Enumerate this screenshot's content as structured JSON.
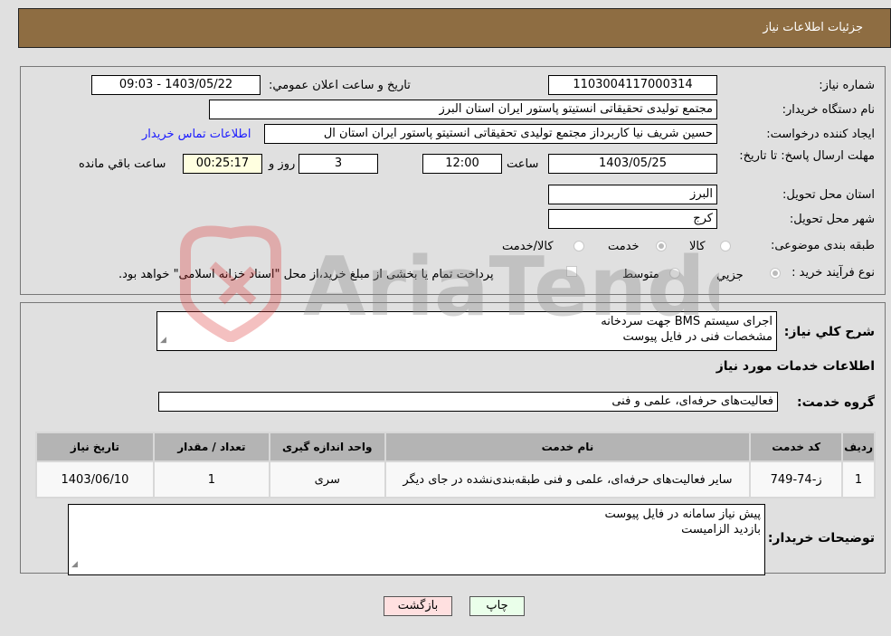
{
  "header": {
    "title": "جزئیات اطلاعات نیاز"
  },
  "form": {
    "need_number_label": "شماره نیاز:",
    "need_number": "1103004117000314",
    "announce_label": "تاریخ و ساعت اعلان عمومي:",
    "announce_value": "1403/05/22 - 09:03",
    "buyer_org_label": "نام دستگاه خريدار:",
    "buyer_org": "مجتمع تولیدی تحقیقاتی انستیتو پاستور ایران استان البرز",
    "creator_label": "ايجاد کننده درخواست:",
    "creator": "حسین شریف نیا کاربرداز مجتمع تولیدی تحقیقاتی انستیتو پاستور ایران استان ال",
    "contact_link": "اطلاعات تماس خريدار",
    "deadline_label": "مهلت ارسال پاسخ: تا تاریخ:",
    "deadline_date": "1403/05/25",
    "time_label": "ساعت",
    "deadline_time": "12:00",
    "days_value": "3",
    "days_label": "روز و",
    "remaining_value": "00:25:17",
    "remaining_label": "ساعت باقي مانده",
    "province_label": "استان محل تحویل:",
    "province": "البرز",
    "city_label": "شهر محل تحویل:",
    "city": "کرج",
    "category_label": "طبقه بندی موضوعی:",
    "category_options": [
      "کالا",
      "خدمت",
      "کالا/خدمت"
    ],
    "category_selected": "خدمت",
    "process_label": "نوع فرآيند خريد :",
    "process_options": [
      "جزيي",
      "متوسط"
    ],
    "process_selected": "جزيي",
    "payment_note": "پرداخت تمام يا بخشی از مبلغ خريد،از محل \"اسناد خزانه اسلامی\" خواهد بود."
  },
  "description": {
    "label": "شرح کلي نياز:",
    "text": "اجرای سیستم BMS جهت سردخانه\nمشخصات فنی در فایل پیوست"
  },
  "services": {
    "section_title": "اطلاعات خدمات مورد نياز",
    "group_label": "گروه خدمت:",
    "group_value": "فعالیت‌های حرفه‌ای، علمی و فنی",
    "table": {
      "headers": [
        "رديف",
        "کد خدمت",
        "نام خدمت",
        "واحد اندازه گيری",
        "تعداد / مقدار",
        "تاريخ نياز"
      ],
      "rows": [
        [
          "1",
          "ز-74-749",
          "سایر فعالیت‌های حرفه‌ای، علمی و فنی طبقه‌بندی‌نشده در جای دیگر",
          "سری",
          "1",
          "1403/06/10"
        ]
      ]
    }
  },
  "buyer_notes": {
    "label": "توضیحات خریدار:",
    "text": "پیش نیاز سامانه در فایل پیوست\nبازدید الزامیست"
  },
  "buttons": {
    "print": "چاپ",
    "back": "بازگشت"
  },
  "watermark": {
    "text": "AriaTender.neT"
  }
}
